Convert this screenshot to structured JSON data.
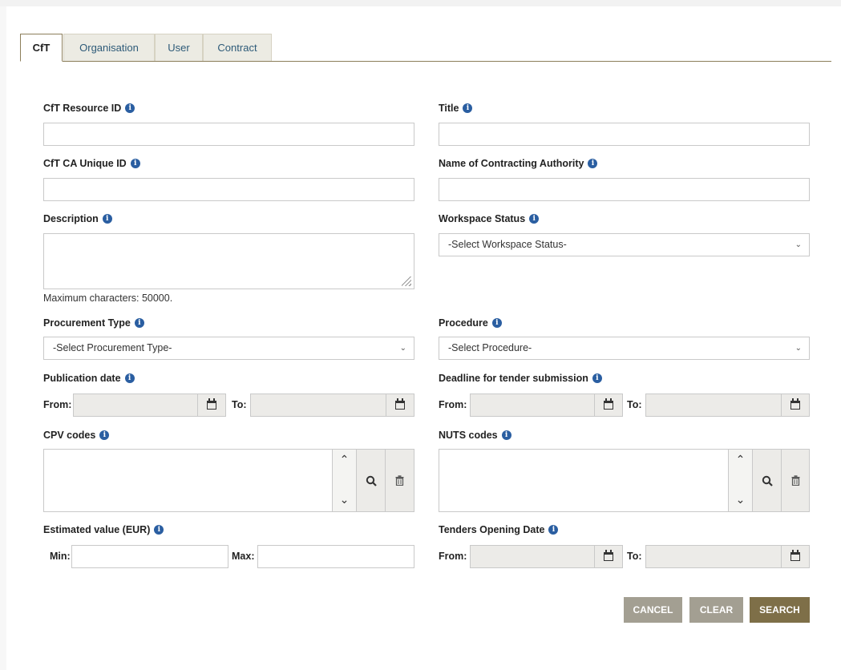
{
  "tabs": [
    {
      "label": "CfT",
      "active": true
    },
    {
      "label": "Organisation",
      "active": false
    },
    {
      "label": "User",
      "active": false
    },
    {
      "label": "Contract",
      "active": false
    }
  ],
  "fields": {
    "cft_resource_id": {
      "label": "CfT Resource ID",
      "value": ""
    },
    "title": {
      "label": "Title",
      "value": ""
    },
    "cft_ca_unique_id": {
      "label": "CfT CA Unique ID",
      "value": ""
    },
    "contracting_authority": {
      "label": "Name of Contracting Authority",
      "value": ""
    },
    "description": {
      "label": "Description",
      "value": "",
      "hint": "Maximum characters: 50000."
    },
    "workspace_status": {
      "label": "Workspace Status",
      "selected": "-Select Workspace Status-"
    },
    "procurement_type": {
      "label": "Procurement Type",
      "selected": "-Select Procurement Type-"
    },
    "procedure": {
      "label": "Procedure",
      "selected": "-Select Procedure-"
    },
    "publication_date": {
      "label": "Publication date",
      "from_label": "From:",
      "to_label": "To:"
    },
    "deadline": {
      "label": "Deadline for tender submission",
      "from_label": "From:",
      "to_label": "To:"
    },
    "cpv_codes": {
      "label": "CPV codes"
    },
    "nuts_codes": {
      "label": "NUTS codes"
    },
    "estimated_value": {
      "label": "Estimated value (EUR)",
      "min_label": "Min:",
      "max_label": "Max:"
    },
    "opening_date": {
      "label": "Tenders Opening Date",
      "from_label": "From:",
      "to_label": "To:"
    }
  },
  "icons": {
    "info": "i",
    "chevron": "⌄",
    "up": "⌃",
    "down": "⌄",
    "search": "🔍",
    "trash": "🗑"
  },
  "buttons": {
    "cancel": "CANCEL",
    "clear": "CLEAR",
    "search": "SEARCH"
  },
  "colors": {
    "accent": "#7e6f48",
    "secondary_button": "#a39f92",
    "info_icon": "#2a5ea1",
    "tab_text": "#2d5a78"
  }
}
